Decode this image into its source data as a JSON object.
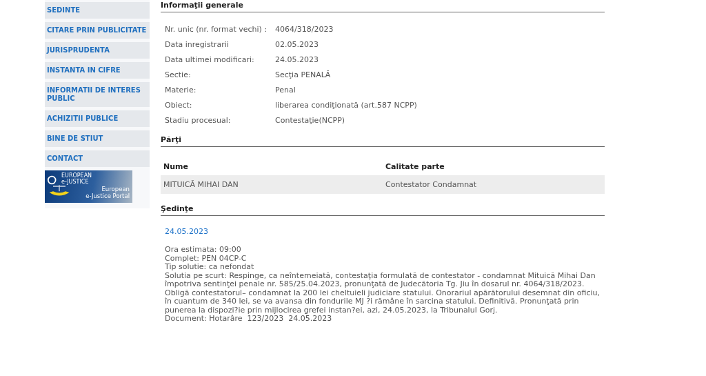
{
  "sidebar": {
    "items": [
      {
        "label": "SEDINTE"
      },
      {
        "label": "CITARE PRIN PUBLICITATE"
      },
      {
        "label": "JURISPRUDENTA"
      },
      {
        "label": "INSTANTA IN CIFRE"
      },
      {
        "label": "INFORMATII DE INTERES PUBLIC"
      },
      {
        "label": "ACHIZITII PUBLICE"
      },
      {
        "label": "BINE DE STIUT"
      },
      {
        "label": "CONTACT"
      }
    ],
    "banner": {
      "logo_lines": [
        "EUROPEAN",
        "e-JUSTICE"
      ],
      "title_lines": [
        "European",
        "e-Justice Portal"
      ]
    }
  },
  "general": {
    "title": "Informaţii generale",
    "fields": [
      {
        "label": "Nr. unic (nr. format vechi) :",
        "value": "4064/318/2023"
      },
      {
        "label": "Data inregistrarii",
        "value": "02.05.2023"
      },
      {
        "label": "Data ultimei modificari:",
        "value": "24.05.2023"
      },
      {
        "label": "Sectie:",
        "value": "Secţia PENALĂ"
      },
      {
        "label": "Materie:",
        "value": "Penal"
      },
      {
        "label": "Obiect:",
        "value": "liberarea condiţionată (art.587 NCPP)"
      },
      {
        "label": "Stadiu procesual:",
        "value": "Contestaţie(NCPP)"
      }
    ]
  },
  "parties": {
    "title": "Părţi",
    "columns": [
      "Nume",
      "Calitate parte"
    ],
    "rows": [
      [
        "MITUICĂ MIHAI DAN",
        "Contestator Condamnat"
      ]
    ]
  },
  "hearings": {
    "title": "Şedinţe",
    "items": [
      {
        "date": "24.05.2023",
        "lines": [
          "Ora estimata: 09:00",
          "Complet: PEN 04CP-C",
          "Tip solutie: ca nefondat",
          "Solutia pe scurt: Respinge, ca neîntemeiată, contestaţia formulată de contestator - condamnat Mituică Mihai Dan împotriva sentinţei penale nr. 585/25.04.2023, pronunţată de Judecătoria Tg. Jiu în dosarul nr. 4064/318/2023. Obligă contestatorul– condamnat la 200 lei cheltuieli judiciare statului. Onorariul apărătorului desemnat din oficiu, în cuantum de 340 lei, se va avansa din fondurile MJ ?i rămâne în sarcina statului. Definitivă. Pronunţată prin punerea la dispozi?ie prin mijlocirea grefei instan?ei, azi, 24.05.2023, la Tribunalul Gorj.",
          "Document: Hotarâre  123/2023  24.05.2023"
        ]
      }
    ]
  }
}
